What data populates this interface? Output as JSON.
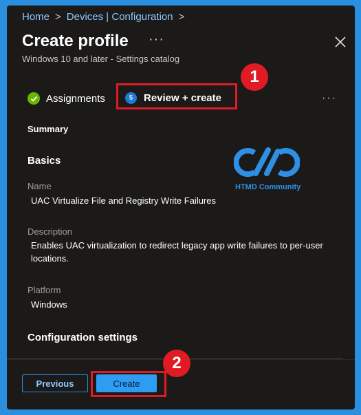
{
  "breadcrumb": {
    "home": "Home",
    "devices": "Devices | Configuration"
  },
  "header": {
    "title": "Create profile",
    "more": "···",
    "subtitle": "Windows 10 and later - Settings catalog"
  },
  "tabs": [
    {
      "label": "Assignments",
      "status": "complete"
    },
    {
      "label": "Review + create",
      "step": "5",
      "active": true
    }
  ],
  "tabs_more": "···",
  "annotations": {
    "badge1": "1",
    "badge2": "2"
  },
  "logo": {
    "text": "HTMD Community"
  },
  "summary": {
    "heading": "Summary",
    "basics_heading": "Basics",
    "name_label": "Name",
    "name_value": "UAC Virtualize File and Registry Write Failures",
    "description_label": "Description",
    "description_value": "Enables UAC virtualization to redirect legacy app write failures to per-user locations.",
    "platform_label": "Platform",
    "platform_value": "Windows",
    "config_heading": "Configuration settings"
  },
  "footer": {
    "previous_label": "Previous",
    "create_label": "Create"
  },
  "colors": {
    "background": "#2b8fe0",
    "panel": "#1b1a19",
    "accent": "#2f9cf4",
    "annotation_red": "#e01b24",
    "success_green": "#6bb700"
  }
}
